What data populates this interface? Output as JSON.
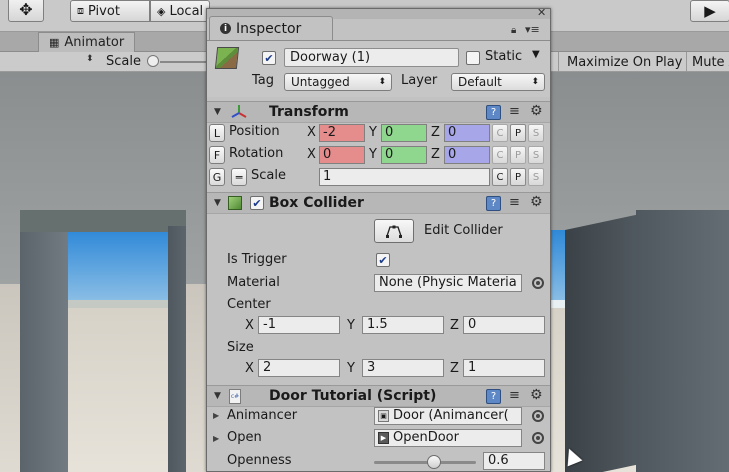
{
  "toolbar": {
    "pivot_label": "Pivot",
    "local_label": "Local"
  },
  "animator_tab": {
    "label": "Animator"
  },
  "game_bar": {
    "scale_label": "Scale",
    "maximize_label": "Maximize On Play",
    "mute_label": "Mute A"
  },
  "inspector": {
    "tab_label": "Inspector",
    "game_object": {
      "name": "Doorway (1)",
      "active": true,
      "static_label": "Static",
      "static": false,
      "tag_label": "Tag",
      "tag_value": "Untagged",
      "layer_label": "Layer",
      "layer_value": "Default"
    },
    "transform": {
      "title": "Transform",
      "rows": [
        {
          "key": "L",
          "label": "Position",
          "x": "-2",
          "y": "0",
          "z": "0"
        },
        {
          "key": "F",
          "label": "Rotation",
          "x": "0",
          "y": "0",
          "z": "0"
        },
        {
          "key": "G",
          "label": "Scale",
          "value": "1"
        }
      ],
      "axis_x": "X",
      "axis_y": "Y",
      "axis_z": "Z",
      "btn_c": "C",
      "btn_p": "P",
      "btn_s": "S"
    },
    "box_collider": {
      "title": "Box Collider",
      "enabled": true,
      "edit_collider_label": "Edit Collider",
      "is_trigger_label": "Is Trigger",
      "is_trigger": true,
      "material_label": "Material",
      "material_value": "None (Physic Materiа",
      "center_label": "Center",
      "center": {
        "x": "-1",
        "y": "1.5",
        "z": "0"
      },
      "size_label": "Size",
      "size": {
        "x": "2",
        "y": "3",
        "z": "1"
      }
    },
    "script": {
      "title": "Door Tutorial (Script)",
      "icon_text": "c#",
      "animancer_label": "Animancer",
      "animancer_value": "Door (Animancer(",
      "open_label": "Open",
      "open_value": "OpenDoor",
      "openness_label": "Openness",
      "openness_value": "0.6",
      "openness_fraction": 0.6
    }
  },
  "icons": {
    "help": "?",
    "gear": "⚙",
    "preset": "≡",
    "check": "✔",
    "fold_open": "▼",
    "fold_closed": "▶"
  }
}
